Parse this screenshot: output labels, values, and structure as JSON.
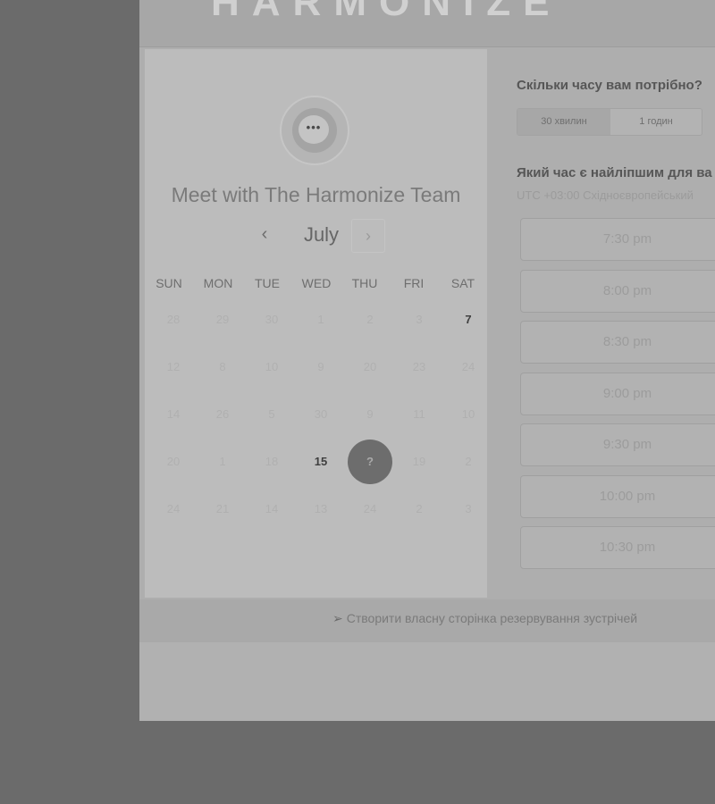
{
  "header": {
    "logo_text": "HARMONIZE"
  },
  "profile": {
    "avatar_glyph": "•••",
    "title": "Meet with The Harmonize Team"
  },
  "calendar": {
    "prev_glyph": "‹",
    "month": "July",
    "next_glyph": "›",
    "weekdays": [
      "SUN",
      "MON",
      "TUE",
      "WED",
      "THU",
      "FRI",
      "SAT"
    ],
    "weeks": [
      [
        "28",
        "29",
        "30",
        "1",
        "2",
        "3",
        "7"
      ],
      [
        "12",
        "8",
        "10",
        "9",
        "20",
        "23",
        "24"
      ],
      [
        "14",
        "26",
        "5",
        "30",
        "9",
        "11",
        "10"
      ],
      [
        "20",
        "1",
        "18",
        "15",
        "?",
        "19",
        "2"
      ],
      [
        "24",
        "21",
        "14",
        "13",
        "24",
        "2",
        "3"
      ]
    ],
    "available_days": [
      "7",
      "15"
    ],
    "selected_day": "?"
  },
  "booking": {
    "duration_question": "Скільки часу вам потрібно?",
    "durations": [
      "30 хвилин",
      "1 годин"
    ],
    "active_duration": "30 хвилин",
    "time_question": "Який час є найліпшим для ва",
    "timezone": "UTC +03:00 Східноєвропейський",
    "slots": [
      "7:30 pm",
      "8:00 pm",
      "8:30 pm",
      "9:00 pm",
      "9:30 pm",
      "10:00 pm",
      "10:30 pm"
    ]
  },
  "footer": {
    "icon_glyph": "➢",
    "link_text": "Створити власну сторінка резервування зустрічей"
  },
  "colors": {
    "overlay": "#6b6b6b",
    "selected_day": "#6d6d6d"
  }
}
